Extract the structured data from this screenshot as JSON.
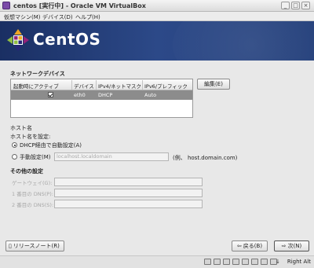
{
  "window": {
    "title": "centos [実行中] - Oracle VM VirtualBox",
    "controls": [
      "_",
      "□",
      "×"
    ]
  },
  "menubar": {
    "items": [
      "仮想マシン(M)",
      "デバイス(D)",
      "ヘルプ(H)"
    ]
  },
  "banner": {
    "logo_text": "CentOS",
    "colors": {
      "background": "#24407b",
      "accent_purple": "#932279",
      "accent_green": "#8fbc42",
      "accent_orange": "#efa724",
      "accent_blue": "#262577"
    }
  },
  "network_devices": {
    "section_label": "ネットワークデバイス",
    "columns": [
      "起動時にアクティブ",
      "デバイス",
      "IPv4/ネットマスク",
      "IPv6/プレフィックス"
    ],
    "rows": [
      {
        "active": true,
        "device": "eth0",
        "ipv4": "DHCP",
        "ipv6": "Auto"
      }
    ],
    "edit_button": "編集(E)"
  },
  "hostname": {
    "section_label": "ホスト名",
    "set_label": "ホスト名を設定:",
    "option_dhcp": "DHCP経由で自動設定(A)",
    "option_manual": "手動設定(M)",
    "manual_placeholder": "localhost.localdomain",
    "example": "(例、 host.domain.com)",
    "selected": "dhcp"
  },
  "other": {
    "section_label": "その他の設定",
    "gateway_label": "ゲートウェイ(G):",
    "dns1_label": "1 番目の DNS(P):",
    "dns2_label": "2 番目の DNS(S):"
  },
  "buttons": {
    "release_notes": "リリースノート(R)",
    "back": "戻る(B)",
    "next": "次(N)"
  },
  "statusbar": {
    "host_key": "Right Alt"
  }
}
